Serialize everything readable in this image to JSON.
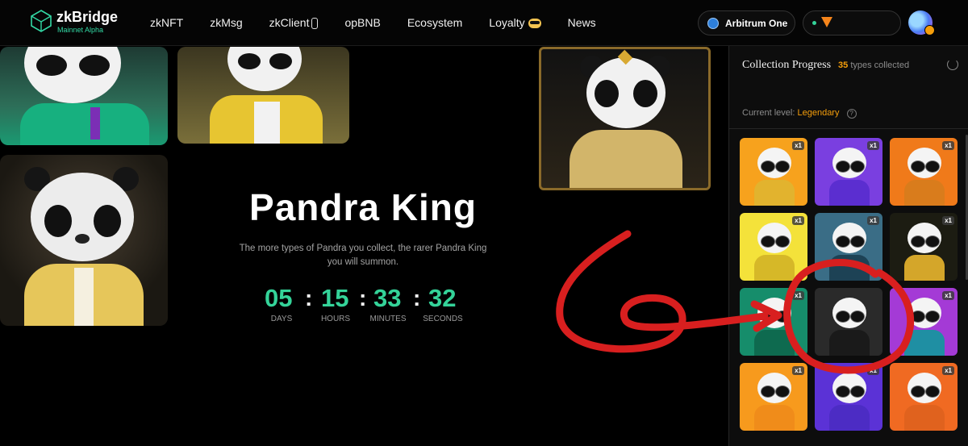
{
  "header": {
    "brand": "zkBridge",
    "brand_sub": "Mainnet Alpha",
    "nav": [
      "zkNFT",
      "zkMsg",
      "zkClient",
      "opBNB",
      "Ecosystem",
      "Loyalty",
      "News"
    ],
    "chain": "Arbitrum One",
    "colors": {
      "accent": "#33d9a5",
      "background": "#050505"
    }
  },
  "hero": {
    "title": "Pandra King",
    "description_line1": "The more types of Pandra you collect, the rarer Pandra King",
    "description_line2": "you will summon.",
    "countdown": {
      "days": "05",
      "hours": "15",
      "minutes": "33",
      "seconds": "32",
      "days_label": "DAYS",
      "hours_label": "HOURS",
      "minutes_label": "MINUTES",
      "seconds_label": "SECONDS"
    }
  },
  "panel": {
    "title": "Collection Progress",
    "count": "35",
    "count_suffix": "types collected",
    "level_label": "Current level:",
    "level_value": "Legendary",
    "help_icon": "?",
    "cards": [
      {
        "badge": "x1",
        "bg": "#f7a21d",
        "body": "#e2b32e"
      },
      {
        "badge": "x1",
        "bg": "#7a3fe0",
        "body": "#5b2ed0"
      },
      {
        "badge": "x1",
        "bg": "#f07a1a",
        "body": "#d97c1c"
      },
      {
        "badge": "x1",
        "bg": "#f4e23a",
        "body": "#d6b828"
      },
      {
        "badge": "x1",
        "bg": "#3a6d86",
        "body": "#1d4255"
      },
      {
        "badge": "x1",
        "bg": "#1c1c12",
        "body": "#d4a62a"
      },
      {
        "badge": "x1",
        "bg": "#168d6b",
        "body": "#0e6a4f"
      },
      {
        "badge": "",
        "bg": "#2a2a2a",
        "body": "#1a1a1a"
      },
      {
        "badge": "x1",
        "bg": "#a43ad6",
        "body": "#1f8fa3"
      },
      {
        "badge": "x1",
        "bg": "#f79a1d",
        "body": "#f08c1a"
      },
      {
        "badge": "x1",
        "bg": "#5b32d6",
        "body": "#4c2cc4"
      },
      {
        "badge": "x1",
        "bg": "#f06a22",
        "body": "#e0621e"
      }
    ]
  },
  "annotation": {
    "color": "#d81f1f"
  }
}
